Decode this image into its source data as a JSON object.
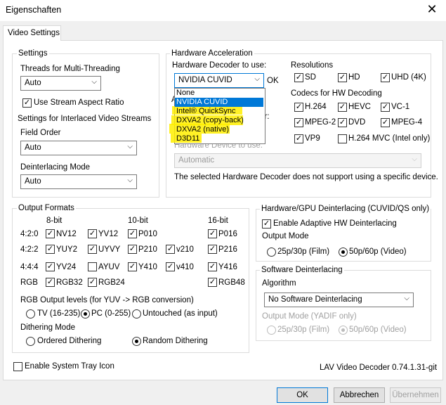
{
  "window": {
    "title": "Eigenschaften",
    "close_glyph": "✕"
  },
  "tab": {
    "label": "Video Settings"
  },
  "settings": {
    "label": "Settings",
    "threads_label": "Threads for Multi-Threading",
    "threads_value": "Auto",
    "stream_aspect_label": "Use Stream Aspect Ratio",
    "stream_aspect_checked": true,
    "interlaced_label": "Settings for Interlaced Video Streams",
    "field_order_label": "Field Order",
    "field_order_value": "Auto",
    "deint_mode_label": "Deinterlacing Mode",
    "deint_mode_value": "Auto"
  },
  "hwaccel": {
    "label": "Hardware Acceleration",
    "decoder_label": "Hardware Decoder to use:",
    "decoder_value": "NVIDIA CUVID",
    "status": "OK",
    "dropdown_options": [
      "None",
      "NVIDIA CUVID",
      "Intel® QuickSync",
      "DXVA2 (copy-back)",
      "DXVA2 (native)",
      "D3D11"
    ],
    "selected_option": "NVIDIA CUVID",
    "device_label": "Hardware Device to use:",
    "device_value": "Automatic",
    "device_note": "The selected Hardware Decoder does not support using a specific device.",
    "partial_a": "A",
    "partial_or": "or:",
    "resolutions_label": "Resolutions",
    "resolutions": [
      {
        "label": "SD",
        "checked": true
      },
      {
        "label": "HD",
        "checked": true
      },
      {
        "label": "UHD (4K)",
        "checked": true
      }
    ],
    "codecs_label": "Codecs for HW Decoding",
    "codecs": [
      {
        "label": "H.264",
        "checked": true
      },
      {
        "label": "HEVC",
        "checked": true
      },
      {
        "label": "VC-1",
        "checked": true
      },
      {
        "label": "MPEG-2",
        "checked": true
      },
      {
        "label": "DVD",
        "checked": true
      },
      {
        "label": "MPEG-4",
        "checked": true
      },
      {
        "label": "VP9",
        "checked": true
      },
      {
        "label": "H.264 MVC (Intel only)",
        "checked": false
      }
    ]
  },
  "output": {
    "label": "Output Formats",
    "col_headers": [
      "8-bit",
      "10-bit",
      "16-bit"
    ],
    "rows": [
      {
        "label": "4:2:0",
        "items": [
          {
            "label": "NV12",
            "checked": true
          },
          {
            "label": "YV12",
            "checked": true
          },
          {
            "label": "P010",
            "checked": true
          },
          {
            "label": "P016",
            "checked": true
          }
        ]
      },
      {
        "label": "4:2:2",
        "items": [
          {
            "label": "YUY2",
            "checked": true
          },
          {
            "label": "UYVY",
            "checked": true
          },
          {
            "label": "P210",
            "checked": true
          },
          {
            "label": "v210",
            "checked": true
          },
          {
            "label": "P216",
            "checked": true
          }
        ]
      },
      {
        "label": "4:4:4",
        "items": [
          {
            "label": "YV24",
            "checked": true
          },
          {
            "label": "AYUV",
            "checked": false
          },
          {
            "label": "Y410",
            "checked": true
          },
          {
            "label": "v410",
            "checked": true
          },
          {
            "label": "Y416",
            "checked": true
          }
        ]
      },
      {
        "label": "RGB",
        "items": [
          {
            "label": "RGB32",
            "checked": true
          },
          {
            "label": "RGB24",
            "checked": true
          },
          {
            "label": "RGB48",
            "checked": true
          }
        ]
      }
    ],
    "rgb_levels_label": "RGB Output levels (for YUV -> RGB conversion)",
    "rgb_levels": [
      {
        "label": "TV (16-235)",
        "selected": false
      },
      {
        "label": "PC (0-255)",
        "selected": true
      },
      {
        "label": "Untouched (as input)",
        "selected": false
      }
    ],
    "dithering_label": "Dithering Mode",
    "dithering": [
      {
        "label": "Ordered Dithering",
        "selected": false
      },
      {
        "label": "Random Dithering",
        "selected": true
      }
    ]
  },
  "hwdeint": {
    "label": "Hardware/GPU Deinterlacing (CUVID/QS only)",
    "adaptive_label": "Enable Adaptive HW Deinterlacing",
    "adaptive_checked": true,
    "output_mode_label": "Output Mode",
    "modes": [
      {
        "label": "25p/30p (Film)",
        "selected": false
      },
      {
        "label": "50p/60p (Video)",
        "selected": true
      }
    ]
  },
  "swdeint": {
    "label": "Software Deinterlacing",
    "algorithm_label": "Algorithm",
    "algorithm_value": "No Software Deinterlacing",
    "output_mode_label": "Output Mode (YADIF only)",
    "modes": [
      {
        "label": "25p/30p (Film)",
        "selected": false
      },
      {
        "label": "50p/60p (Video)",
        "selected": true
      }
    ]
  },
  "tray": {
    "label": "Enable System Tray Icon",
    "checked": false
  },
  "version": "LAV Video Decoder 0.74.1.31-git",
  "buttons": {
    "ok": "OK",
    "cancel": "Abbrechen",
    "apply": "Übernehmen"
  },
  "glyphs": {
    "check": "✓",
    "arrow": "⌵"
  }
}
